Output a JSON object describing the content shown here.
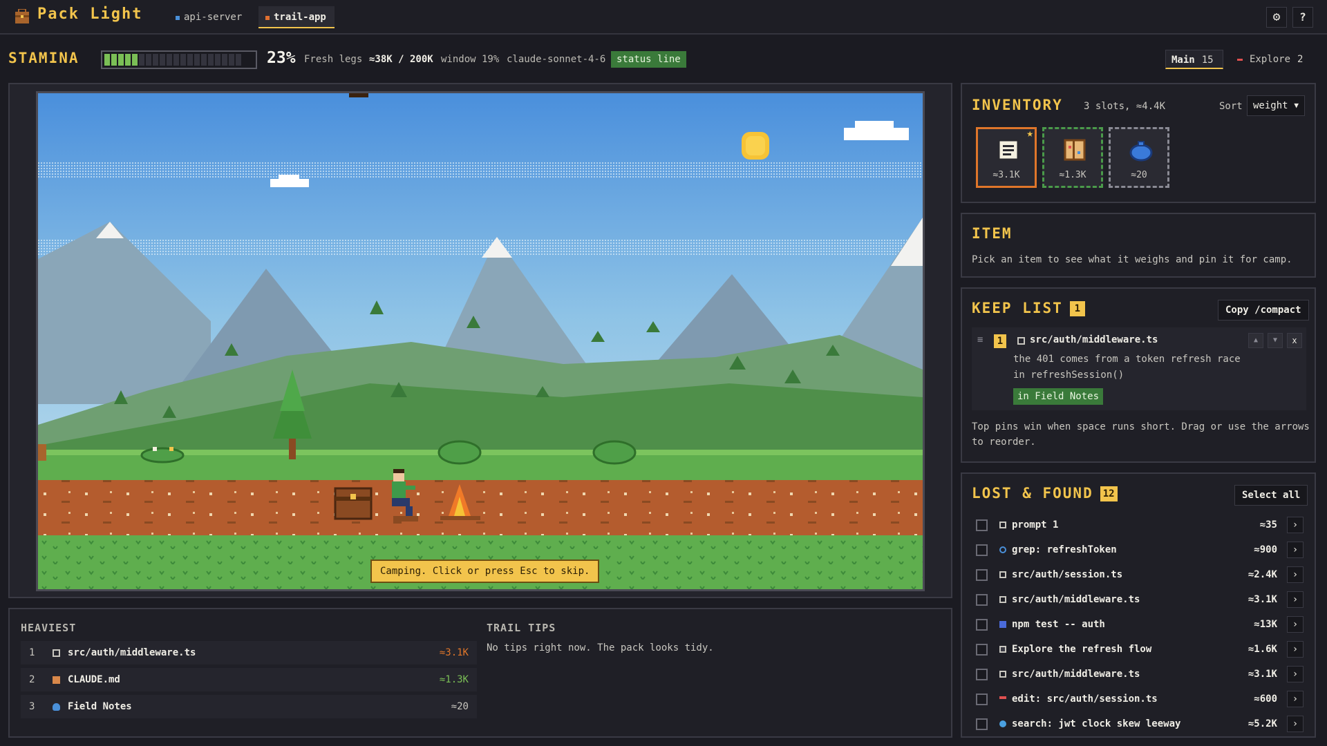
{
  "app": {
    "title": "Pack Light",
    "tabs": [
      {
        "label": "api-server",
        "color": "#4a90d9"
      },
      {
        "label": "trail-app",
        "color": "#e07030",
        "active": true
      }
    ],
    "settings_icon": "gear-icon",
    "help_label": "?"
  },
  "stamina": {
    "label": "STAMINA",
    "percent_label": "23%",
    "level": 0.23,
    "state": "Fresh legs",
    "tokens": "≈38K / 200K",
    "window": "window 19%",
    "model": "claude-sonnet-4-6",
    "status_badge": "status line"
  },
  "agents": {
    "main": {
      "label": "Main",
      "count": "15"
    },
    "explore": {
      "label": "Explore",
      "count": "2"
    }
  },
  "scene": {
    "toast": "Camping. Click or press Esc to skip."
  },
  "heaviest": {
    "title": "HEAVIEST",
    "items": [
      {
        "rank": "1",
        "name": "src/auth/middleware.ts",
        "weight": "≈3.1K",
        "icon": "file-icon",
        "color": "#e0762a"
      },
      {
        "rank": "2",
        "name": "CLAUDE.md",
        "weight": "≈1.3K",
        "icon": "map-icon",
        "color": "#7bbf56"
      },
      {
        "rank": "3",
        "name": "Field Notes",
        "weight": "≈20",
        "icon": "pouch-icon",
        "color": "#c9c7c0"
      }
    ]
  },
  "trail_tips": {
    "title": "TRAIL TIPS",
    "text": "No tips right now. The pack looks tidy."
  },
  "inventory": {
    "title": "INVENTORY",
    "summary": "3 slots, ≈4.4K",
    "sort_label": "Sort",
    "sort_value": "weight",
    "slots": [
      {
        "weight": "≈3.1K",
        "icon": "scroll-icon",
        "pinned": true
      },
      {
        "weight": "≈1.3K",
        "icon": "map-icon"
      },
      {
        "weight": "≈20",
        "icon": "pouch-icon"
      }
    ]
  },
  "item": {
    "title": "ITEM",
    "hint": "Pick an item to see what it weighs and pin it for camp."
  },
  "keep_list": {
    "title": "KEEP LIST",
    "count": "1",
    "copy_button": "Copy /compact",
    "entries": [
      {
        "index": "1",
        "file": "src/auth/middleware.ts",
        "note_line1": "the 401 comes from a token refresh race",
        "note_line2": "in refreshSession()",
        "tag": "in Field Notes"
      }
    ],
    "hint_line1": "Top pins win when space runs short. Drag or use the arrows",
    "hint_line2": "to reorder."
  },
  "lost_found": {
    "title": "LOST & FOUND",
    "count": "12",
    "select_all": "Select all",
    "items": [
      {
        "name": "prompt 1",
        "weight": "≈35",
        "icon": "chat-icon",
        "color": "#c9c7c0"
      },
      {
        "name": "grep: refreshToken",
        "weight": "≈900",
        "icon": "magnifier-icon",
        "color": "#4a90d9"
      },
      {
        "name": "src/auth/session.ts",
        "weight": "≈2.4K",
        "icon": "file-icon",
        "color": "#c9c7c0"
      },
      {
        "name": "src/auth/middleware.ts",
        "weight": "≈3.1K",
        "icon": "file-icon",
        "color": "#c9c7c0"
      },
      {
        "name": "npm test -- auth",
        "weight": "≈13K",
        "icon": "terminal-icon",
        "color": "#4a6ad9"
      },
      {
        "name": "Explore the refresh flow",
        "weight": "≈1.6K",
        "icon": "envelope-icon",
        "color": "#c9c7c0"
      },
      {
        "name": "src/auth/middleware.ts",
        "weight": "≈3.1K",
        "icon": "file-icon",
        "color": "#c9c7c0"
      },
      {
        "name": "edit: src/auth/session.ts",
        "weight": "≈600",
        "icon": "hammer-icon",
        "color": "#e05050"
      },
      {
        "name": "search: jwt clock skew leeway",
        "weight": "≈5.2K",
        "icon": "globe-icon",
        "color": "#4aa0e0"
      }
    ]
  }
}
